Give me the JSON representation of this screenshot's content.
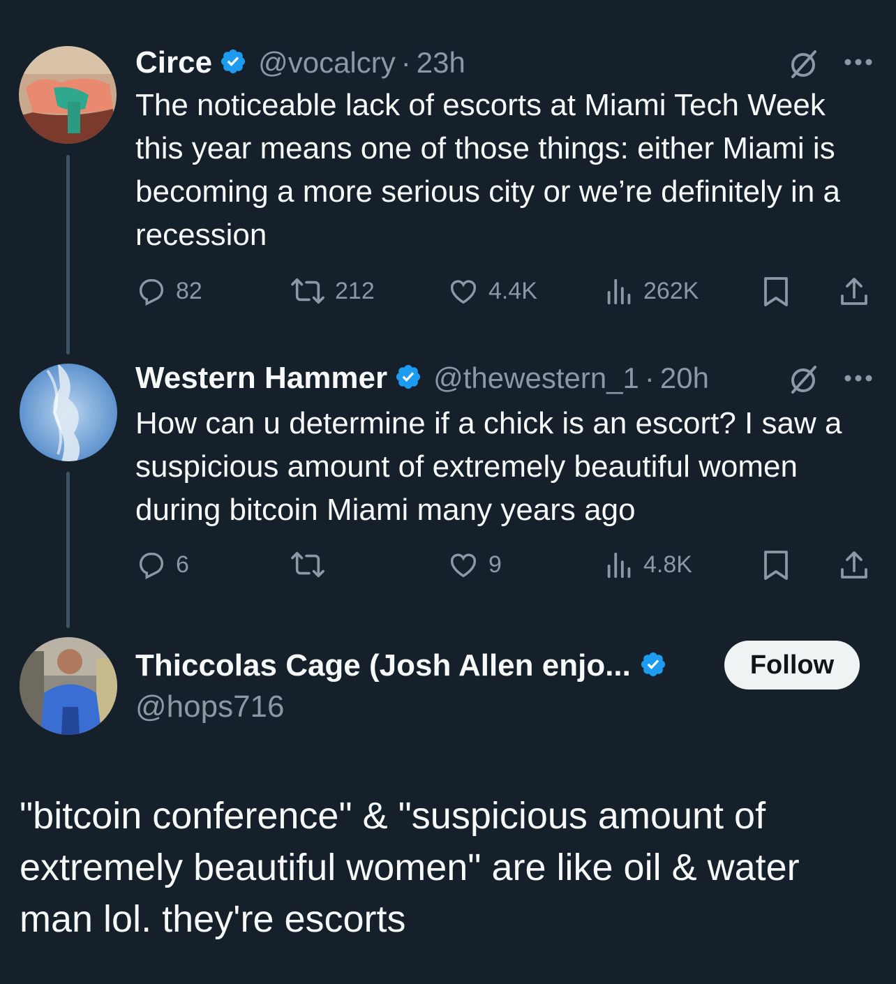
{
  "tweets": [
    {
      "name": "Circe",
      "handle": "@vocalcry",
      "time": "23h",
      "text": "The noticeable lack of escorts at Miami Tech Week this year means one of those things: either Miami is becoming a more serious city or we’re definitely in a recession",
      "replies": "82",
      "retweets": "212",
      "likes": "4.4K",
      "views": "262K"
    },
    {
      "name": "Western Hammer",
      "handle": "@thewestern_1",
      "time": "20h",
      "text": "How can u determine if a chick is an escort? I saw a suspicious amount of extremely beautiful women during bitcoin Miami many years ago",
      "replies": "6",
      "retweets": "",
      "likes": "9",
      "views": "4.8K"
    }
  ],
  "main": {
    "name": "Thiccolas Cage (Josh Allen enjo...",
    "handle": "@hops716",
    "follow_label": "Follow",
    "text": "\"bitcoin conference\" & \"suspicious amount of extremely beautiful women\" are like oil & water man lol. they're escorts"
  },
  "separator": "·",
  "colors": {
    "background": "#15202b",
    "text": "#f7f9f9",
    "muted": "#8b98a5",
    "verified": "#1d9bf0",
    "thread_line": "#3d5466",
    "follow_bg": "#eff3f4"
  },
  "icons": [
    "verified-badge-icon",
    "grok-icon",
    "more-icon",
    "reply-icon",
    "retweet-icon",
    "like-icon",
    "views-icon",
    "bookmark-icon",
    "share-icon"
  ]
}
